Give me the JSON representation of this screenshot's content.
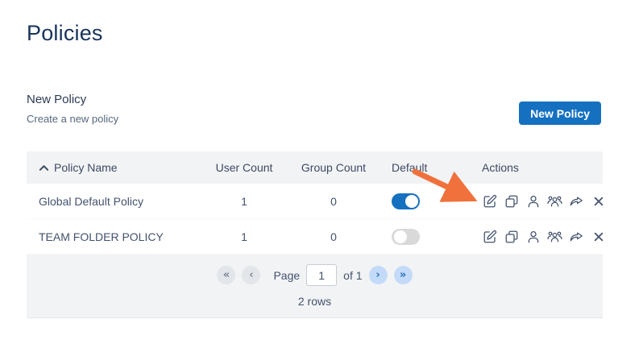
{
  "page": {
    "title": "Policies"
  },
  "section": {
    "heading": "New Policy",
    "subheading": "Create a new policy",
    "button_label": "New Policy"
  },
  "table": {
    "columns": [
      "Policy Name",
      "User Count",
      "Group Count",
      "Default",
      "Actions"
    ],
    "sort": {
      "column": "Policy Name",
      "direction": "ascending"
    },
    "rows": [
      {
        "name": "Global Default Policy",
        "user_count": "1",
        "group_count": "0",
        "default_on": true
      },
      {
        "name": "TEAM FOLDER POLICY",
        "user_count": "1",
        "group_count": "0",
        "default_on": false
      }
    ],
    "row_actions": [
      "edit",
      "copy",
      "manage-users",
      "manage-groups",
      "export",
      "delete"
    ]
  },
  "pagination": {
    "first_symbol": "«",
    "prev_symbol": "‹",
    "next_symbol": "›",
    "last_symbol": "»",
    "page_label": "Page",
    "current_page": "1",
    "of_label": "of 1",
    "rows_summary": "2 rows"
  },
  "colors": {
    "primary_blue": "#1570c0",
    "title_navy": "#17335b",
    "table_header_bg": "#f2f3f5",
    "icon_slate": "#42526e",
    "annotation_arrow_orange": "#f0713c",
    "toggle_off_gray": "#d9d9d9",
    "pager_enabled_bg": "#c3dbf8",
    "pager_disabled_bg": "#e2e5e9"
  }
}
